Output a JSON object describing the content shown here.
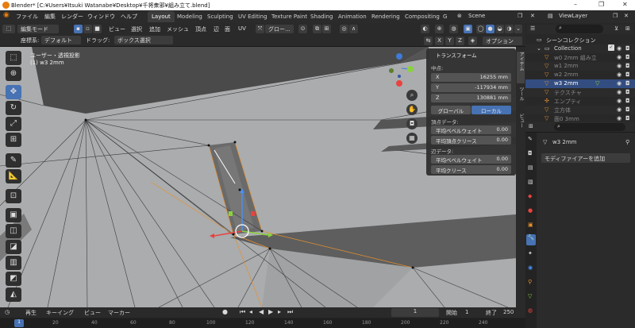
{
  "titlebar": {
    "title": "Blender* [C:¥Users¥Itsuki Watanabe¥Desktop¥千将衆邪¥組み立て.blend]",
    "minimize": "–",
    "maximize": "❐",
    "close": "✕"
  },
  "menu": {
    "items": [
      "ファイル",
      "編集",
      "レンダー",
      "ウィンドウ",
      "ヘルプ"
    ],
    "tabs": [
      "Layout",
      "Modeling",
      "Sculpting",
      "UV Editing",
      "Texture Paint",
      "Shading",
      "Animation",
      "Rendering",
      "Compositing",
      "G"
    ],
    "active_tab": "Layout",
    "scene": "Scene",
    "view_layer": "ViewLayer"
  },
  "viewport_header": {
    "mode": "編集モード",
    "menus": [
      "ビュー",
      "選択",
      "追加",
      "メッシュ",
      "頂点",
      "辺",
      "面",
      "UV"
    ],
    "orientation": "グロー..."
  },
  "tool_header": {
    "coord_label": "座標系:",
    "coord_value": "デフォルト",
    "drag_label": "ドラッグ:",
    "drag_value": "ボックス選択",
    "options": "オプション",
    "axes": [
      "X",
      "Y",
      "Z"
    ]
  },
  "viewport_overlay": {
    "view_name": "ユーザー・透視投影",
    "object_name": "(1) w3 2mm"
  },
  "n_panel": {
    "header": "トランスフォーム",
    "median_label": "中点:",
    "x_label": "X",
    "x_value": "16255 mm",
    "y_label": "Y",
    "y_value": "-117934 mm",
    "z_label": "Z",
    "z_value": "130881 mm",
    "global": "グローバル",
    "local": "ローカル",
    "vertex_data_label": "頂点データ:",
    "bevel_weight_label": "平均ベベルウェイト",
    "bevel_weight_value": "0.00",
    "vertex_crease_label": "平均頂点クリース",
    "vertex_crease_value": "0.00",
    "edge_data_label": "辺データ:",
    "edge_bevel_label": "平均ベベルウェイト",
    "edge_bevel_value": "0.00",
    "edge_crease_label": "平均クリース",
    "edge_crease_value": "0.00"
  },
  "side_tabs": [
    "アイテム",
    "ツール",
    "ビュー"
  ],
  "outliner": {
    "root": "シーンコレクション",
    "collection": "Collection",
    "items": [
      {
        "name": "w0 2mm 組み立"
      },
      {
        "name": "w1 2mm"
      },
      {
        "name": "w2 2mm"
      },
      {
        "name": "w3 2mm"
      },
      {
        "name": "テクスチャ"
      },
      {
        "name": "エンプティ"
      },
      {
        "name": "立方体"
      },
      {
        "name": "面0 3mm"
      }
    ],
    "selected_index": 3
  },
  "properties": {
    "object_name": "w3 2mm",
    "add_modifier": "モディファイアーを追加"
  },
  "timeline": {
    "playback": "再生",
    "keying": "キーイング",
    "view": "ビュー",
    "marker": "マーカー",
    "current_frame": "1",
    "start_label": "開始",
    "start_value": "1",
    "end_label": "終了",
    "end_value": "250",
    "ticks": [
      "1",
      "20",
      "40",
      "60",
      "80",
      "100",
      "120",
      "140",
      "160",
      "180",
      "200",
      "220",
      "240"
    ]
  },
  "colors": {
    "accent": "#4772b3",
    "viewport_bg": "#a7a9ab",
    "mesh_dark": "#5e5e5e",
    "selection_orange": "#e8912d"
  }
}
